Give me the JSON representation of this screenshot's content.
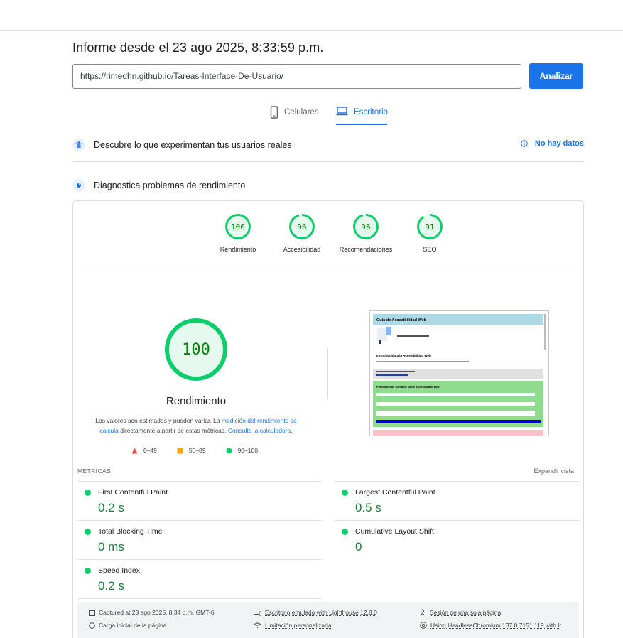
{
  "header": {
    "title": "Informe desde el 23 ago 2025, 8:33:59 p.m.",
    "url_value": "https://rimedhn.github.io/Tareas-Interface-De-Usuario/",
    "analyze_label": "Analizar"
  },
  "tabs": [
    {
      "label": "Celulares",
      "icon": "smartphone-icon",
      "active": false
    },
    {
      "label": "Escritorio",
      "icon": "laptop-icon",
      "active": true
    }
  ],
  "crux": {
    "title": "Descubre lo que experimentan tus usuarios reales",
    "no_data": "No hay datos"
  },
  "diagnostics": {
    "title": "Diagnostica problemas de rendimiento"
  },
  "categories": [
    {
      "score": "100",
      "label": "Rendimiento",
      "fraction": 1.0,
      "color": "#0cce6b"
    },
    {
      "score": "96",
      "label": "Accesibilidad",
      "fraction": 0.96,
      "color": "#0cce6b"
    },
    {
      "score": "96",
      "label": "Recomendaciones",
      "fraction": 0.96,
      "color": "#0cce6b"
    },
    {
      "score": "91",
      "label": "SEO",
      "fraction": 0.91,
      "color": "#0cce6b"
    }
  ],
  "main_gauge": {
    "score": "100",
    "label": "Rendimiento",
    "desc_prefix": "Los valores son estimados y pueden variar. La ",
    "desc_link1": "medición del rendimiento se calcula",
    "desc_middle": " directamente a partir de estas métricas. ",
    "desc_link2": "Consulta la calculadora",
    "desc_suffix": "."
  },
  "legend": [
    {
      "range": "0–49",
      "shape": "triangle",
      "color": "#ff4e42"
    },
    {
      "range": "50–89",
      "shape": "square",
      "color": "#ffa400"
    },
    {
      "range": "90–100",
      "shape": "circle",
      "color": "#0cce6b"
    }
  ],
  "screenshot": {
    "header": "Guía de Accesibilidad Web",
    "intro_title": "Introducción a la Accesibilidad Web",
    "form_title": "Formulario de Contacto sobre Accesibilidad Web"
  },
  "metrics": {
    "heading": "MÉTRICAS",
    "expand_label": "Expandir vista",
    "items": [
      {
        "name": "First Contentful Paint",
        "value": "0.2 s"
      },
      {
        "name": "Largest Contentful Paint",
        "value": "0.5 s"
      },
      {
        "name": "Total Blocking Time",
        "value": "0 ms"
      },
      {
        "name": "Cumulative Layout Shift",
        "value": "0"
      },
      {
        "name": "Speed Index",
        "value": "0.2 s"
      }
    ]
  },
  "footer": {
    "captured": "Captured at 23 ago 2025, 8:34 p.m. GMT-6",
    "load": "Carga inicial de la página",
    "emulated": "Escritorio emulado with Lighthouse 12.8.0",
    "throttling": "Limitación personalizada",
    "session": "Sesión de una sola página",
    "browser": "Using HeadlessChromium 137.0.7151.119 with lr"
  }
}
